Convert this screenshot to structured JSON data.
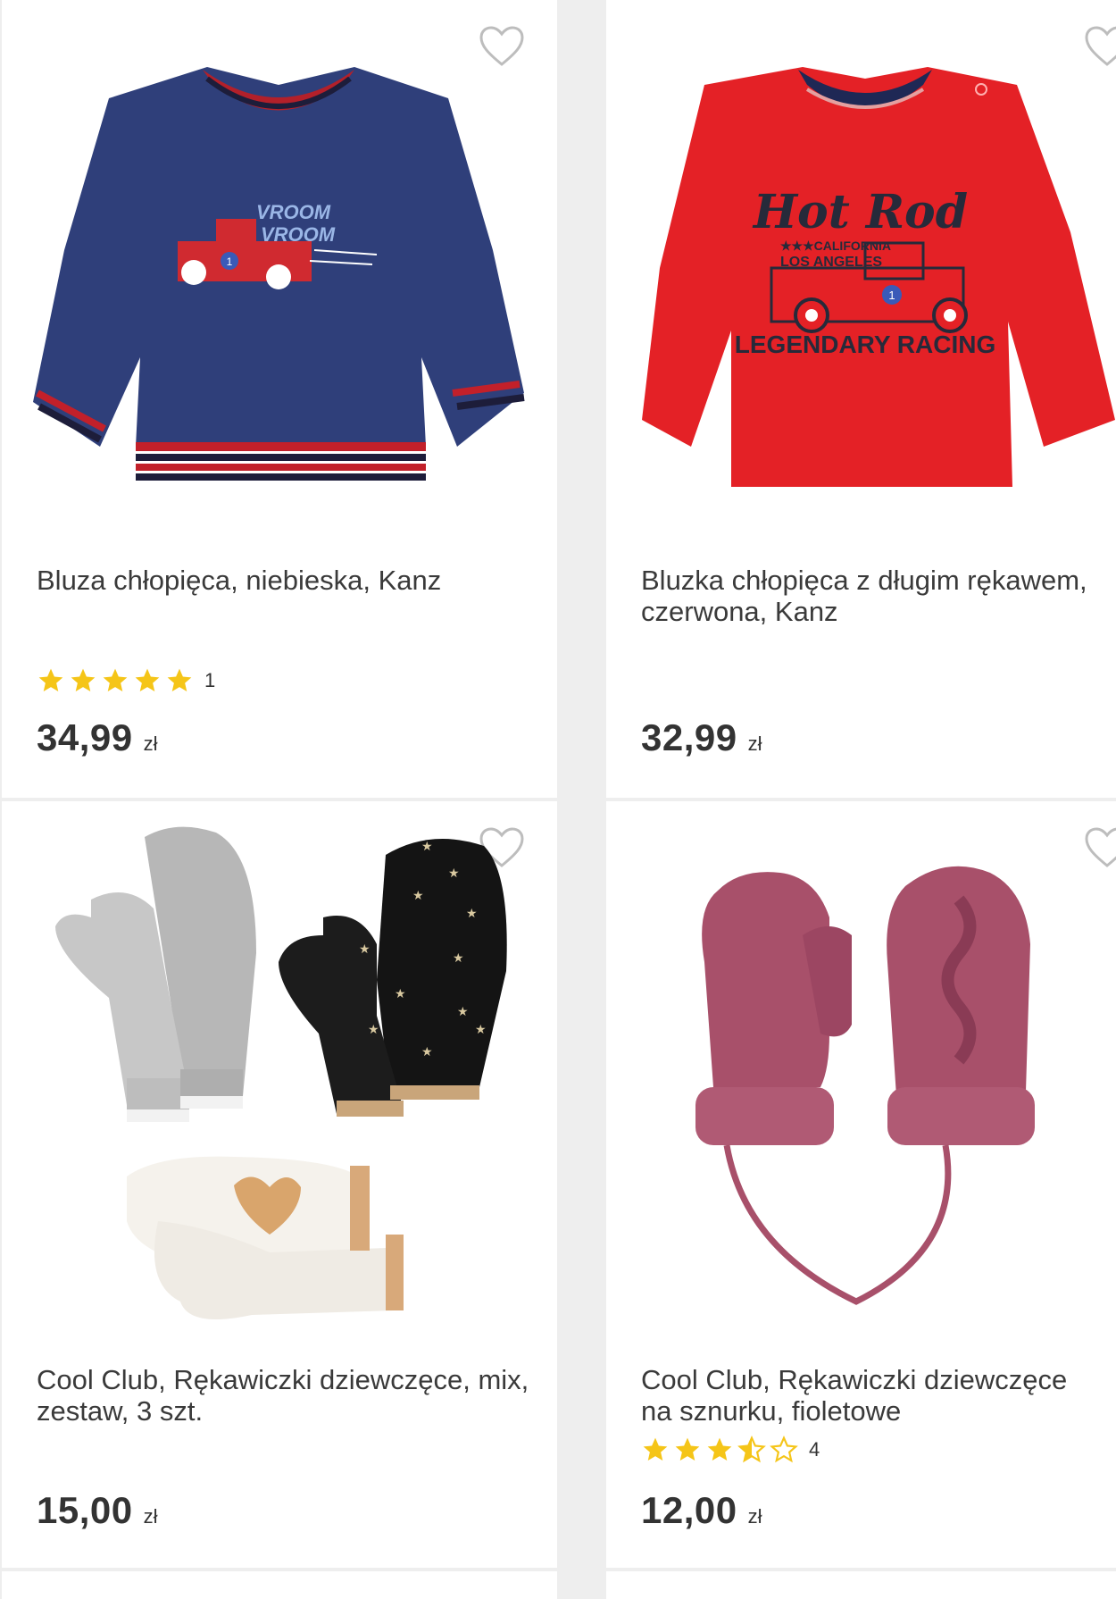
{
  "products": [
    {
      "title": "Bluza chłopięca, niebieska, Kanz",
      "rating_count": "1",
      "rating": 5,
      "price": "34,99",
      "currency": "zł",
      "print_line1": "VROOM",
      "print_line2": "VROOM",
      "badge": "1"
    },
    {
      "title": "Bluzka chłopięca z długim rękawem, czerwona, Kanz",
      "price": "32,99",
      "currency": "zł",
      "print_title": "Hot Rod",
      "print_sub1": "★★★CALIFORNIA",
      "print_sub2": "LOS ANGELES",
      "print_bottom": "LEGENDARY RACING",
      "badge": "1"
    },
    {
      "title": "Cool Club, Rękawiczki dziewczęce, mix, zestaw, 3 szt.",
      "price": "15,00",
      "currency": "zł"
    },
    {
      "title": "Cool Club, Rękawiczki dziewczęce na sznurku, fioletowe",
      "rating_count": "4",
      "rating": 3.5,
      "price": "12,00",
      "currency": "zł"
    }
  ],
  "colors": {
    "star": "#f5c518",
    "heart": "#bdbdbd",
    "navy": "#2f3f7a",
    "red": "#e42126",
    "mauve": "#a8506a"
  }
}
